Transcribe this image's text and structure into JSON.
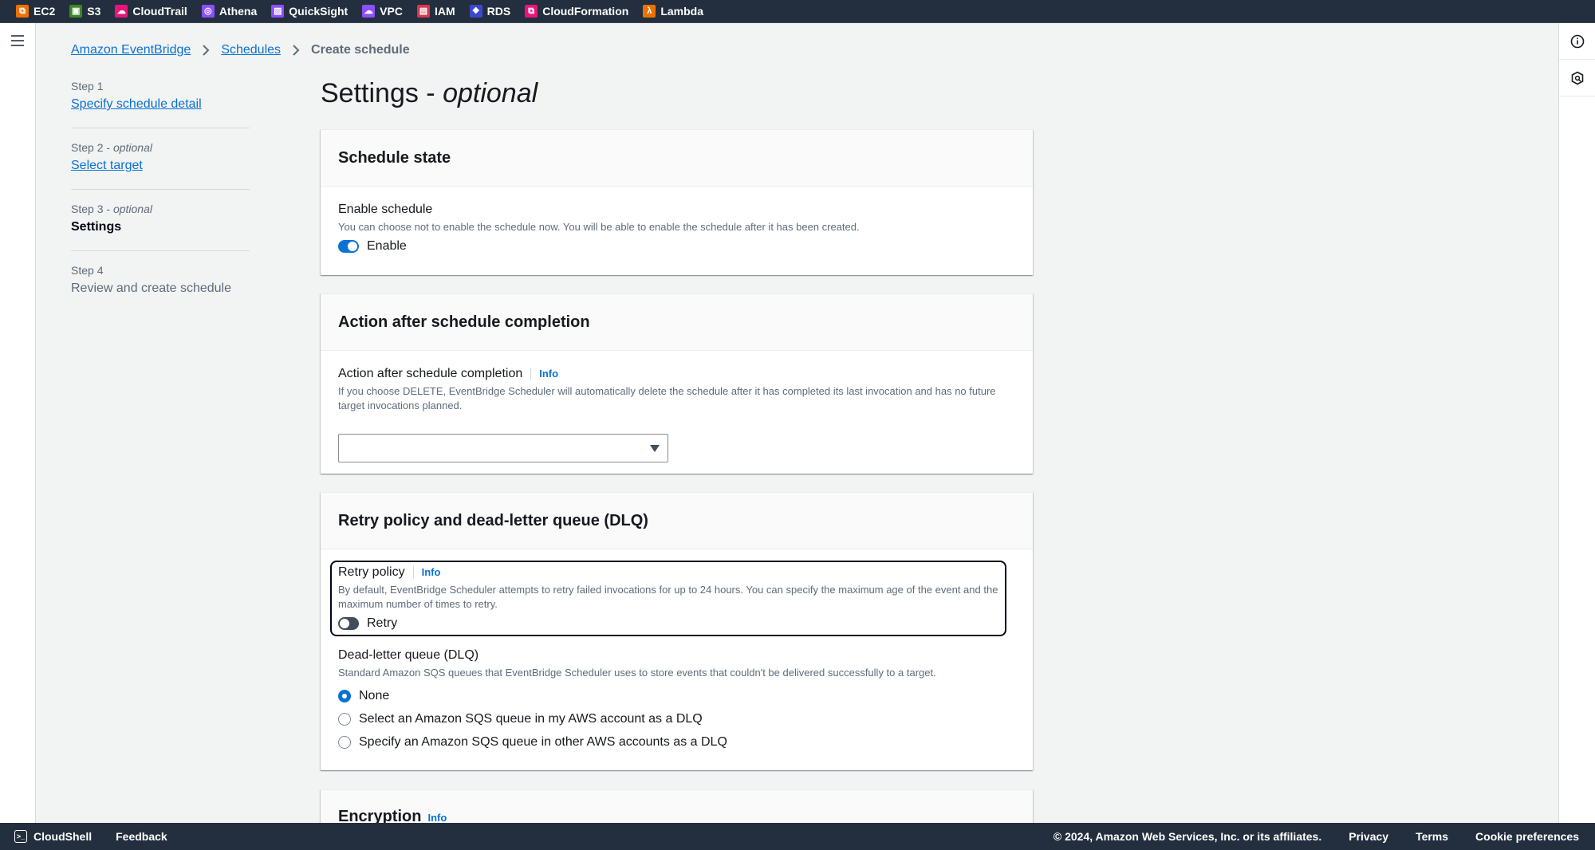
{
  "topbar": {
    "services": [
      {
        "label": "EC2",
        "icon": "ec2-icon",
        "color": "#ed7100",
        "glyph": "⧉"
      },
      {
        "label": "S3",
        "icon": "s3-icon",
        "color": "#3f8624",
        "glyph": "▣"
      },
      {
        "label": "CloudTrail",
        "icon": "cloudtrail-icon",
        "color": "#e7157b",
        "glyph": "☁"
      },
      {
        "label": "Athena",
        "icon": "athena-icon",
        "color": "#8c4fff",
        "glyph": "◎"
      },
      {
        "label": "QuickSight",
        "icon": "quicksight-icon",
        "color": "#8c4fff",
        "glyph": "▨"
      },
      {
        "label": "VPC",
        "icon": "vpc-icon",
        "color": "#8c4fff",
        "glyph": "☁"
      },
      {
        "label": "IAM",
        "icon": "iam-icon",
        "color": "#dd344c",
        "glyph": "▤"
      },
      {
        "label": "RDS",
        "icon": "rds-icon",
        "color": "#3b48cc",
        "glyph": "❖"
      },
      {
        "label": "CloudFormation",
        "icon": "cloudformation-icon",
        "color": "#e7157b",
        "glyph": "⧉"
      },
      {
        "label": "Lambda",
        "icon": "lambda-icon",
        "color": "#ed7100",
        "glyph": "λ"
      }
    ]
  },
  "breadcrumb": {
    "items": [
      "Amazon EventBridge",
      "Schedules"
    ],
    "current": "Create schedule"
  },
  "steps": [
    {
      "num": "Step 1",
      "optional": "",
      "title": "Specify schedule detail",
      "state": "link"
    },
    {
      "num": "Step 2",
      "optional": "optional",
      "title": "Select target",
      "state": "link"
    },
    {
      "num": "Step 3",
      "optional": "optional",
      "title": "Settings",
      "state": "current"
    },
    {
      "num": "Step 4",
      "optional": "",
      "title": "Review and create schedule",
      "state": "disabled"
    }
  ],
  "page": {
    "title": "Settings - ",
    "title_italic": "optional"
  },
  "schedule_state": {
    "header": "Schedule state",
    "label": "Enable schedule",
    "description": "You can choose not to enable the schedule now. You will be able to enable the schedule after it has been created.",
    "toggle_label": "Enable",
    "enabled": true
  },
  "action_after": {
    "header": "Action after schedule completion",
    "label": "Action after schedule completion",
    "info": "Info",
    "description": "If you choose DELETE, EventBridge Scheduler will automatically delete the schedule after it has completed its last invocation and has no future target invocations planned.",
    "selected_value": ""
  },
  "retry": {
    "header": "Retry policy and dead-letter queue (DLQ)",
    "policy_label": "Retry policy",
    "info": "Info",
    "policy_description": "By default, EventBridge Scheduler attempts to retry failed invocations for up to 24 hours. You can specify the maximum age of the event and the maximum number of times to retry.",
    "toggle_label": "Retry",
    "retry_enabled": false,
    "dlq_label": "Dead-letter queue (DLQ)",
    "dlq_description": "Standard Amazon SQS queues that EventBridge Scheduler uses to store events that couldn't be delivered successfully to a target.",
    "dlq_options": [
      {
        "label": "None",
        "checked": true
      },
      {
        "label": "Select an Amazon SQS queue in my AWS account as a DLQ",
        "checked": false
      },
      {
        "label": "Specify an Amazon SQS queue in other AWS accounts as a DLQ",
        "checked": false
      }
    ]
  },
  "encryption": {
    "header": "Encryption",
    "info": "Info"
  },
  "footer": {
    "cloudshell": "CloudShell",
    "feedback": "Feedback",
    "copyright": "© 2024, Amazon Web Services, Inc. or its affiliates.",
    "privacy": "Privacy",
    "terms": "Terms",
    "cookies": "Cookie preferences"
  }
}
